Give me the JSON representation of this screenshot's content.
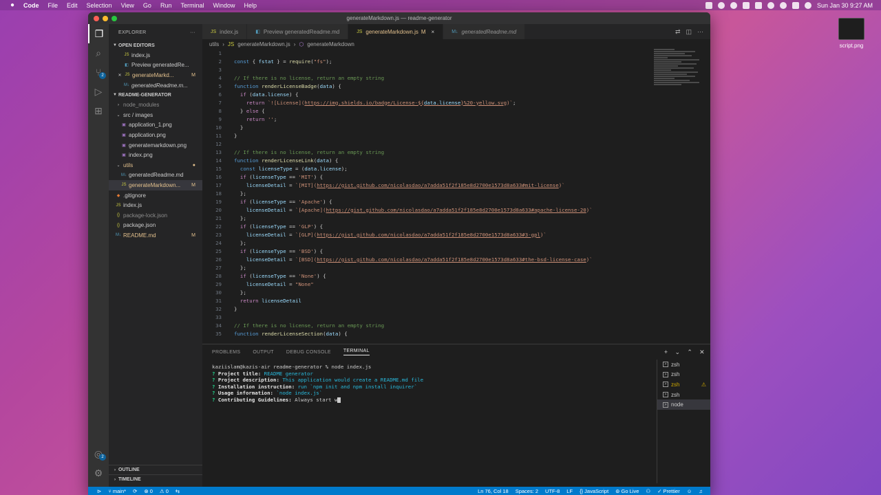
{
  "menubar": {
    "app": "Code",
    "items": [
      "File",
      "Edit",
      "Selection",
      "View",
      "Go",
      "Run",
      "Terminal",
      "Window",
      "Help"
    ],
    "clock": "Sun Jan 30  9:27 AM"
  },
  "desktop": {
    "file_name": "script.png"
  },
  "window": {
    "title": "generateMarkdown.js — readme-generator"
  },
  "activitybar": {
    "scm_badge": "2",
    "accounts_badge": "2"
  },
  "sidebar": {
    "header": "EXPLORER",
    "open_editors_title": "OPEN EDITORS",
    "open_editors": [
      {
        "label": "index.js",
        "mark": ""
      },
      {
        "label": "Preview generatedRe...",
        "mark": ""
      },
      {
        "label": "generateMarkd...",
        "mark": "M"
      },
      {
        "label": "generatedReadme.m...",
        "mark": ""
      }
    ],
    "project_title": "README-GENERATOR",
    "tree": [
      {
        "label": "node_modules",
        "mark": ""
      },
      {
        "label": "src / images",
        "mark": ""
      },
      {
        "label": "application_1.png",
        "mark": ""
      },
      {
        "label": "application.png",
        "mark": ""
      },
      {
        "label": "generatemarkdown.png",
        "mark": ""
      },
      {
        "label": "index.png",
        "mark": ""
      },
      {
        "label": "utils",
        "mark": ""
      },
      {
        "label": "generatedReadme.md",
        "mark": ""
      },
      {
        "label": "generateMarkdown...",
        "mark": "M"
      },
      {
        "label": ".gitignore",
        "mark": ""
      },
      {
        "label": "index.js",
        "mark": ""
      },
      {
        "label": "package-lock.json",
        "mark": ""
      },
      {
        "label": "package.json",
        "mark": ""
      },
      {
        "label": "README.md",
        "mark": "M"
      }
    ],
    "outline": "OUTLINE",
    "timeline": "TIMELINE"
  },
  "tabs": [
    {
      "label": "index.js",
      "mod": "",
      "close": ""
    },
    {
      "label": "Preview generatedReadme.md",
      "mod": "",
      "close": ""
    },
    {
      "label": "generateMarkdown.js",
      "mod": "M",
      "close": "×"
    },
    {
      "label": "generatedReadme.md",
      "mod": "",
      "close": ""
    }
  ],
  "breadcrumb": [
    "utils",
    "›",
    "generateMarkdown.js",
    "›",
    "generateMarkdown"
  ],
  "code": {
    "line_numbers": [
      "1",
      "2",
      "3",
      "4",
      "5",
      "6",
      "7",
      "8",
      "9",
      "10",
      "11",
      "12",
      "13",
      "14",
      "15",
      "16",
      "17",
      "18",
      "19",
      "20",
      "21",
      "22",
      "23",
      "24",
      "25",
      "26",
      "27",
      "28",
      "29",
      "30",
      "31",
      "32",
      "33",
      "34",
      "35"
    ]
  },
  "panel": {
    "tabs": [
      "PROBLEMS",
      "OUTPUT",
      "DEBUG CONSOLE",
      "TERMINAL"
    ],
    "terminal": {
      "prompt": "kaziislam@kazis-air readme-generator % node index.js",
      "q1_label": "Project title:",
      "q1_answer": "README generator",
      "q2_label": "Project description:",
      "q2_answer": "This application would create a README.md file",
      "q3_label": "Installation instruction:",
      "q3_answer": "run `npm init and npm install inquirer`",
      "q4_label": "Usage information:",
      "q4_answer": "`node index.js`",
      "q5_label": "Contributing Guidelines:",
      "q5_input": "Always start w"
    },
    "terminals": [
      "zsh",
      "zsh",
      "zsh",
      "zsh",
      "node"
    ]
  },
  "statusbar": {
    "branch": "main*",
    "errors": "⊗ 0",
    "warnings": "⚠ 0",
    "position": "Ln 76, Col 18",
    "spaces": "Spaces: 2",
    "encoding": "UTF-8",
    "eol": "LF",
    "language": "JavaScript",
    "golive": "Go Live",
    "prettier": "Prettier"
  }
}
